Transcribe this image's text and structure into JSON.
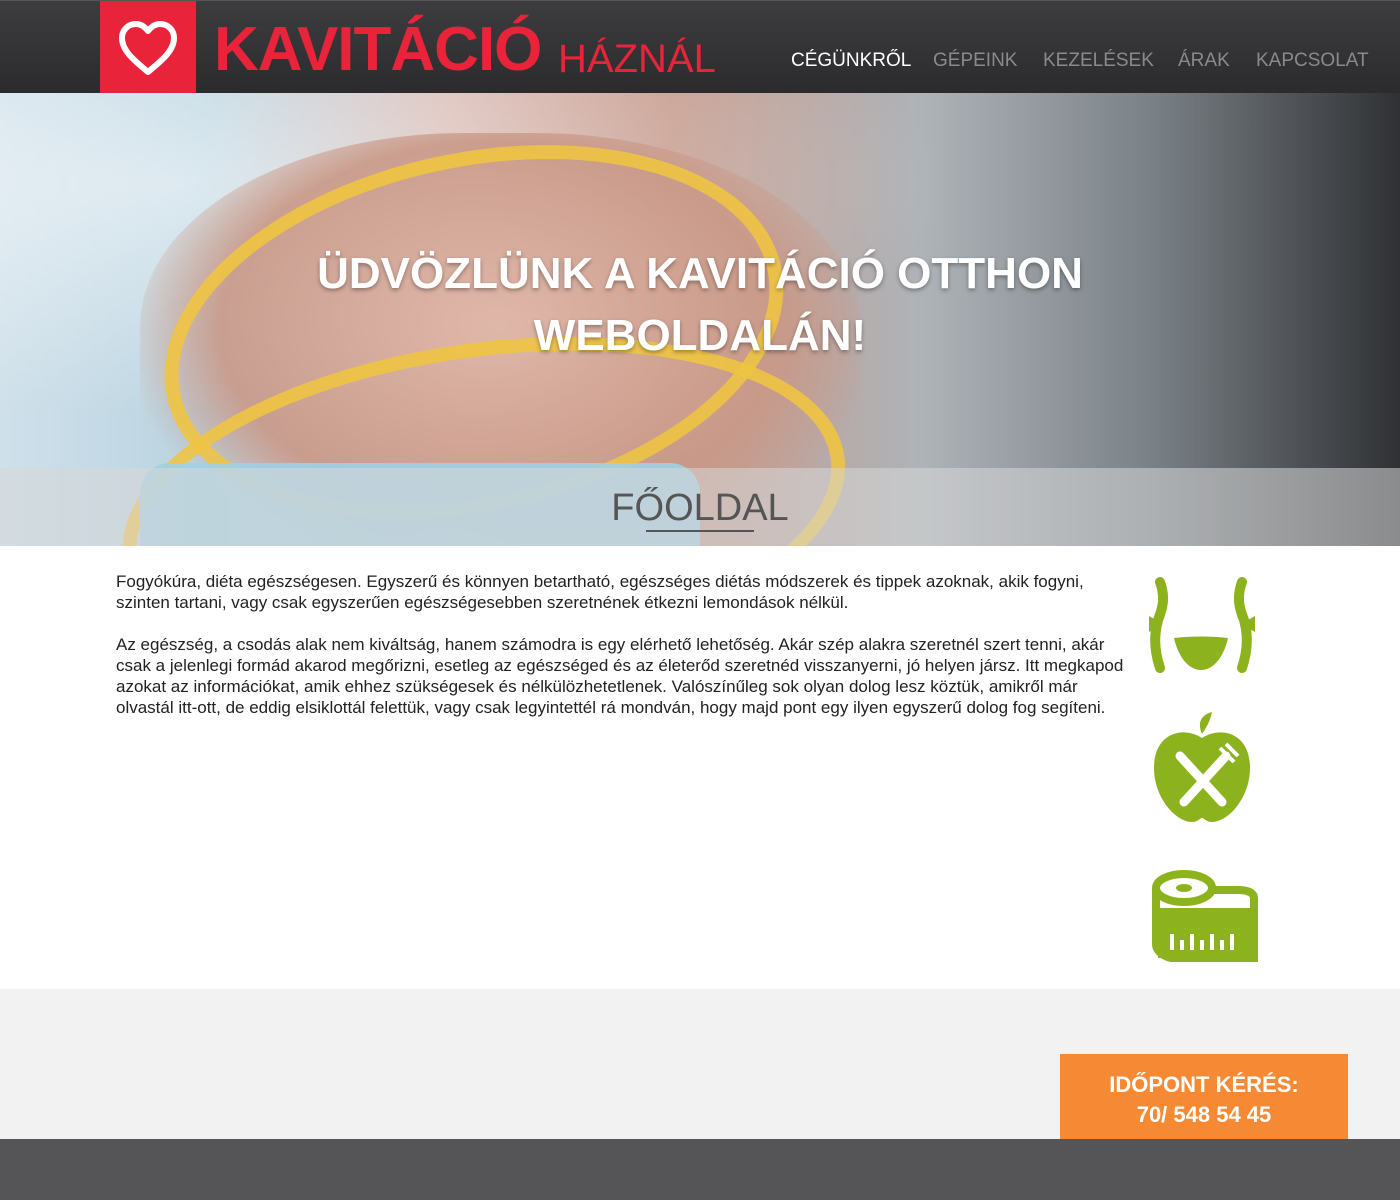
{
  "header": {
    "brand_main": "KAVITÁCIÓ",
    "brand_sub": "HÁZNÁL",
    "logo_icon": "heart-icon",
    "nav": [
      {
        "label": "CÉGÜNKRŐL",
        "active": true
      },
      {
        "label": "GÉPEINK",
        "active": false
      },
      {
        "label": "KEZELÉSEK",
        "active": false
      },
      {
        "label": "ÁRAK",
        "active": false
      },
      {
        "label": "KAPCSOLAT",
        "active": false
      }
    ]
  },
  "hero": {
    "title_line1": "ÜDVÖZLÜNK A KAVITÁCIÓ OTTHON",
    "title_line2": "WEBOLDALÁN!"
  },
  "page": {
    "heading": "FŐOLDAL"
  },
  "content": {
    "paragraph1": "Fogyókúra, diéta egészségesen. Egyszerű és könnyen betartható, egészséges diétás módszerek és tippek azoknak, akik fogyni, szinten tartani, vagy csak egyszerűen egészségesebben szeretnének étkezni lemondások nélkül.",
    "paragraph2": "Az egészség, a csodás alak nem kiváltság, hanem számodra is egy elérhető lehetőség. Akár szép alakra szeretnél szert tenni, akár csak a jelenlegi formád akarod megőrizni, esetleg az egészséged és az életerőd szeretnéd visszanyerni, jó helyen jársz. Itt megkapod azokat az információkat, amik ehhez szükségesek és nélkülözhetetlenek. Valószínűleg sok olyan dolog lesz köztük, amikről már olvastál itt-ott, de eddig elsiklottál felettük, vagy csak legyintettél rá mondván, hogy majd pont egy ilyen egyszerű dolog fog segíteni."
  },
  "icons": [
    "waist-slimming-icon",
    "apple-cutlery-icon",
    "measuring-tape-icon"
  ],
  "cta": {
    "line1": "IDŐPONT KÉRÉS:",
    "line2": "70/ 548 54 45"
  },
  "colors": {
    "brand_red": "#e8233a",
    "icon_green": "#8cb21d",
    "cta_orange": "#f68a34",
    "header_dark": "#333335",
    "footer_gray": "#555558"
  }
}
